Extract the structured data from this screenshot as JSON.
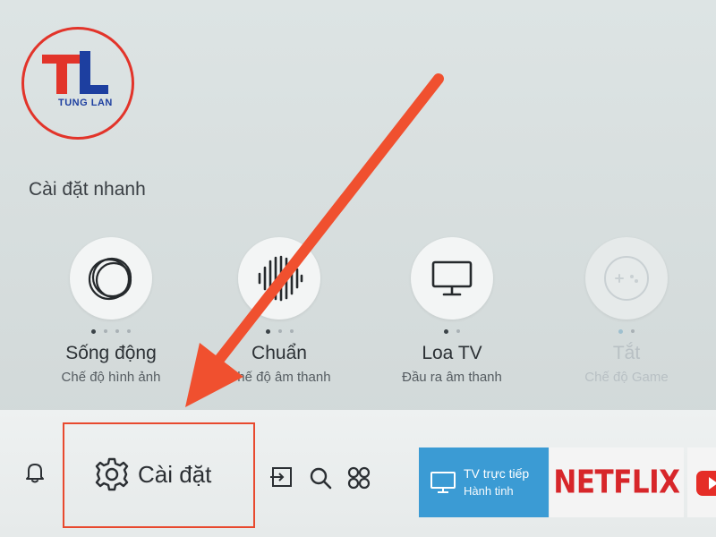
{
  "watermark": {
    "logo_letters": "TL",
    "brand": "TUNG LAN"
  },
  "quick_settings": {
    "title": "Cài đặt nhanh",
    "items": [
      {
        "label": "Sống động",
        "sub": "Chế độ hình ảnh",
        "icon": "picture-mode-icon",
        "dots": 4,
        "active_dot": 0,
        "enabled": true
      },
      {
        "label": "Chuẩn",
        "sub": "Chế độ âm thanh",
        "icon": "sound-mode-icon",
        "dots": 3,
        "active_dot": 0,
        "enabled": true
      },
      {
        "label": "Loa TV",
        "sub": "Đầu ra âm thanh",
        "icon": "tv-speaker-icon",
        "dots": 2,
        "active_dot": 0,
        "enabled": true
      },
      {
        "label": "Tắt",
        "sub": "Chế độ Game",
        "icon": "gamepad-icon",
        "dots": 2,
        "active_dot": 0,
        "enabled": false
      }
    ]
  },
  "bottom_bar": {
    "settings_label": "Cài đặt",
    "live_tv": {
      "line1": "TV trực tiếp",
      "line2": "Hành tinh"
    },
    "netflix_label": "NETFLIX"
  },
  "colors": {
    "highlight": "#e8492e",
    "live_tile": "#3b9bd4",
    "netflix_red": "#d7262a",
    "logo_red": "#e2342a",
    "logo_blue": "#1d3fa0"
  }
}
